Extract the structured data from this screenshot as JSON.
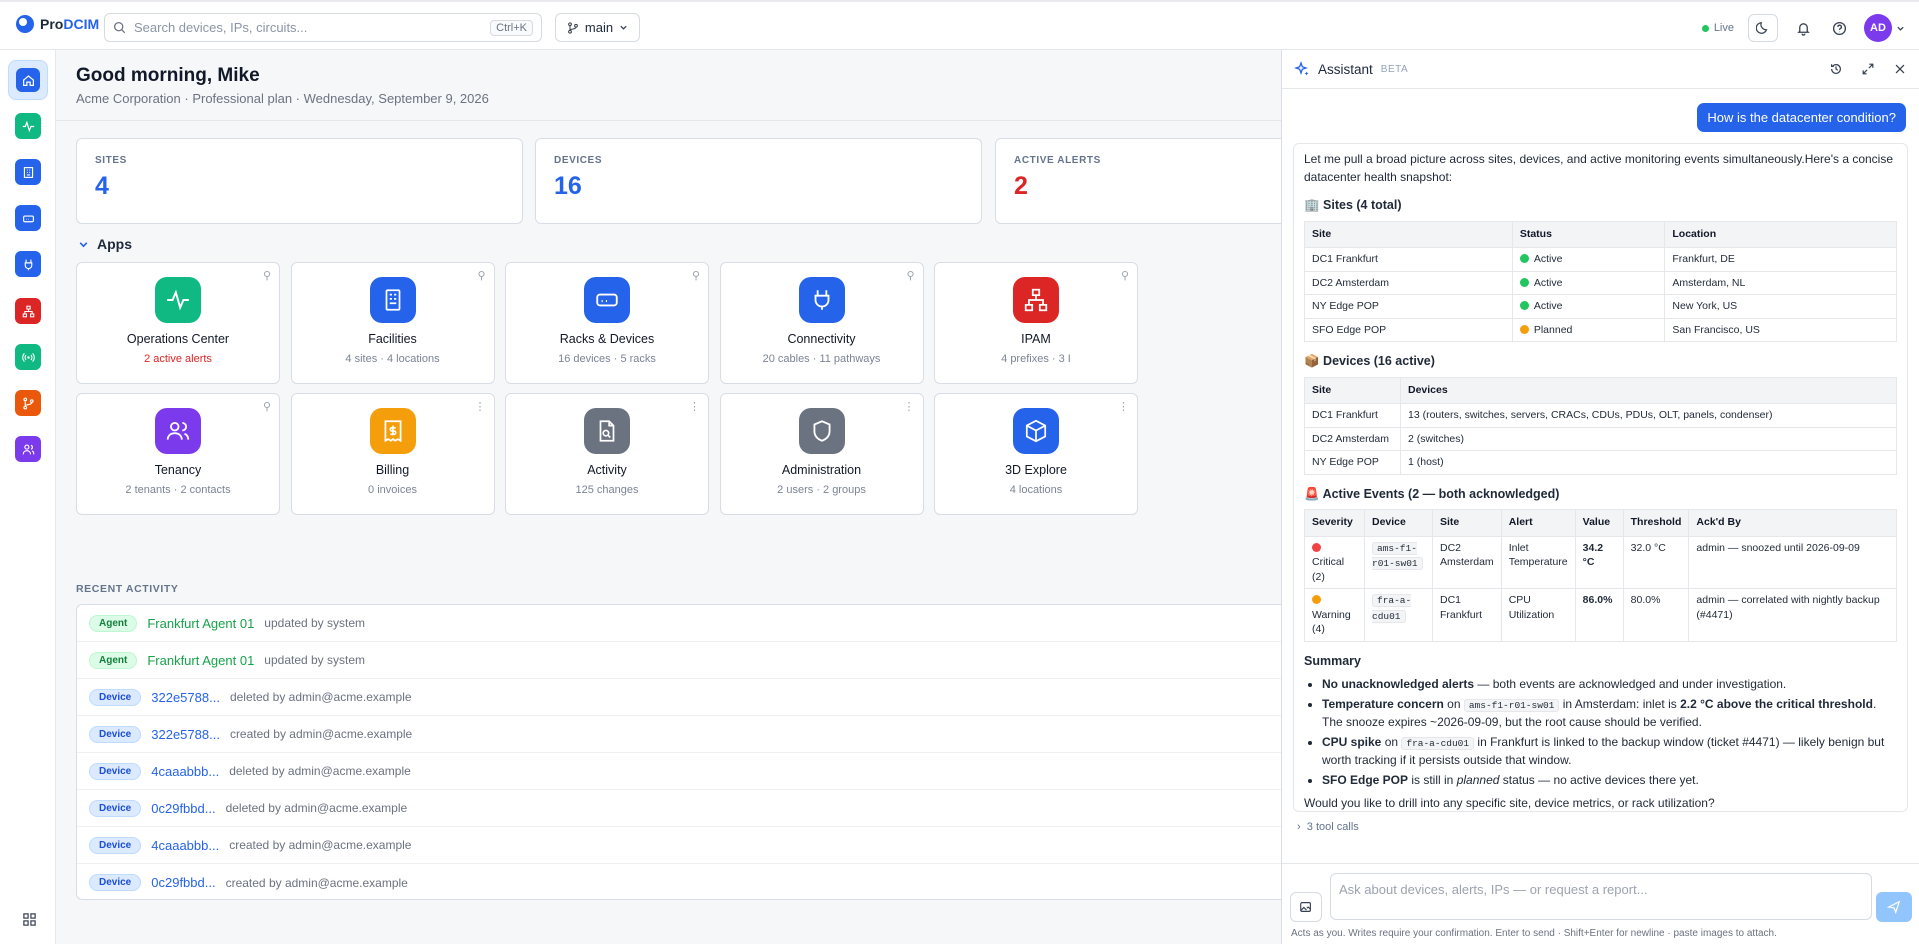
{
  "app": {
    "brand_a": "Pro",
    "brand_b": "DCIM",
    "search_placeholder": "Search devices, IPs, circuits...",
    "search_kbd": "Ctrl+K",
    "branch": "main",
    "live": "Live",
    "avatar": "AD"
  },
  "header": {
    "greeting": "Good morning, Mike",
    "subtitle": "Acme Corporation · Professional plan · Wednesday, September 9, 2026"
  },
  "stats": [
    {
      "label": "SITES",
      "value": "4",
      "color": "#2563eb"
    },
    {
      "label": "DEVICES",
      "value": "16",
      "color": "#2563eb"
    },
    {
      "label": "ACTIVE ALERTS",
      "value": "2",
      "color": "#dc2626"
    }
  ],
  "apps_title": "Apps",
  "apps": [
    {
      "title": "Operations Center",
      "sub": "2 active alerts",
      "icon": "pulse-icon",
      "color": "#10b981",
      "alert": true
    },
    {
      "title": "Facilities",
      "sub": "4 sites · 4 locations",
      "icon": "building-icon",
      "color": "#2563eb"
    },
    {
      "title": "Racks & Devices",
      "sub": "16 devices · 5 racks",
      "icon": "server-icon",
      "color": "#2563eb"
    },
    {
      "title": "Connectivity",
      "sub": "20 cables · 11 pathways",
      "icon": "plug-icon",
      "color": "#2563eb"
    },
    {
      "title": "IPAM",
      "sub": "4 prefixes · 3 I",
      "icon": "network-icon",
      "color": "#dc2626"
    },
    {
      "title": "Tenancy",
      "sub": "2 tenants · 2 contacts",
      "icon": "users-icon",
      "color": "#7c3aed"
    },
    {
      "title": "Billing",
      "sub": "0 invoices",
      "icon": "receipt-icon",
      "color": "#f59e0b"
    },
    {
      "title": "Activity",
      "sub": "125 changes",
      "icon": "file-search-icon",
      "color": "#6b7280"
    },
    {
      "title": "Administration",
      "sub": "2 users · 2 groups",
      "icon": "shield-icon",
      "color": "#6b7280"
    },
    {
      "title": "3D Explore",
      "sub": "4 locations",
      "icon": "cube-icon",
      "color": "#2563eb"
    }
  ],
  "recent_title": "RECENT ACTIVITY",
  "recent": [
    {
      "type": "Agent",
      "name": "Frankfurt Agent 01",
      "action": "updated by system"
    },
    {
      "type": "Agent",
      "name": "Frankfurt Agent 01",
      "action": "updated by system"
    },
    {
      "type": "Device",
      "name": "322e5788...",
      "action": "deleted by admin@acme.example"
    },
    {
      "type": "Device",
      "name": "322e5788...",
      "action": "created by admin@acme.example"
    },
    {
      "type": "Device",
      "name": "4caaabbb...",
      "action": "deleted by admin@acme.example"
    },
    {
      "type": "Device",
      "name": "0c29fbbd...",
      "action": "deleted by admin@acme.example"
    },
    {
      "type": "Device",
      "name": "4caaabbb...",
      "action": "created by admin@acme.example"
    },
    {
      "type": "Device",
      "name": "0c29fbbd...",
      "action": "created by admin@acme.example"
    }
  ],
  "assistant": {
    "title": "Assistant",
    "beta": "BETA",
    "user_msg": "How is the datacenter condition?",
    "intro": "Let me pull a broad picture across sites, devices, and active monitoring events simultaneously.Here's a concise datacenter health snapshot:",
    "sites_h": "🏢 Sites (4 total)",
    "sites_cols": [
      "Site",
      "Status",
      "Location"
    ],
    "sites": [
      [
        "DC1 Frankfurt",
        "Active",
        "Frankfurt, DE"
      ],
      [
        "DC2 Amsterdam",
        "Active",
        "Amsterdam, NL"
      ],
      [
        "NY Edge POP",
        "Active",
        "New York, US"
      ],
      [
        "SFO Edge POP",
        "Planned",
        "San Francisco, US"
      ]
    ],
    "devices_h": "📦 Devices (16 active)",
    "devices_cols": [
      "Site",
      "Devices"
    ],
    "devices": [
      [
        "DC1 Frankfurt",
        "13 (routers, switches, servers, CRACs, CDUs, PDUs, OLT, panels, condenser)"
      ],
      [
        "DC2 Amsterdam",
        "2 (switches)"
      ],
      [
        "NY Edge POP",
        "1 (host)"
      ]
    ],
    "events_h": "🚨 Active Events (2 — both acknowledged)",
    "events_cols": [
      "Severity",
      "Device",
      "Site",
      "Alert",
      "Value",
      "Threshold",
      "Ack'd By"
    ],
    "events": [
      {
        "sev": "Critical (2)",
        "dev": "ams-f1-r01-sw01",
        "site": "DC2 Amsterdam",
        "alert": "Inlet Temperature",
        "value": "34.2 °C",
        "thr": "32.0 °C",
        "ack": "admin — snoozed until 2026-09-09",
        "dot": "#ef4444"
      },
      {
        "sev": "Warning (4)",
        "dev": "fra-a-cdu01",
        "site": "DC1 Frankfurt",
        "alert": "CPU Utilization",
        "value": "86.0%",
        "thr": "80.0%",
        "ack": "admin — correlated with nightly backup (#4471)",
        "dot": "#f59e0b"
      }
    ],
    "summary_h": "Summary",
    "s1_b": "No unacknowledged alerts",
    "s1": " — both events are acknowledged and under investigation.",
    "s2_b": "Temperature concern",
    "s2_a": " on ",
    "s2_code": "ams-f1-r01-sw01",
    "s2_c": " in Amsterdam: inlet is ",
    "s2_b2": "2.2 °C above the critical threshold",
    "s2_d": ". The snooze expires ~2026-09-09, but the root cause should be verified.",
    "s3_b": "CPU spike",
    "s3_a": " on ",
    "s3_code": "fra-a-cdu01",
    "s3_c": " in Frankfurt is linked to the backup window (ticket #4471) — likely benign but worth tracking if it persists outside that window.",
    "s4_b": "SFO Edge POP",
    "s4_a": " is still in ",
    "s4_i": "planned",
    "s4_c": " status — no active devices there yet.",
    "closing": "Would you like to drill into any specific site, device metrics, or rack utilization?",
    "tool_calls": "3 tool calls",
    "placeholder": "Ask about devices, alerts, IPs — or request a report...",
    "hint": "Acts as you. Writes require your confirmation. Enter to send · Shift+Enter for newline · paste images to attach."
  }
}
